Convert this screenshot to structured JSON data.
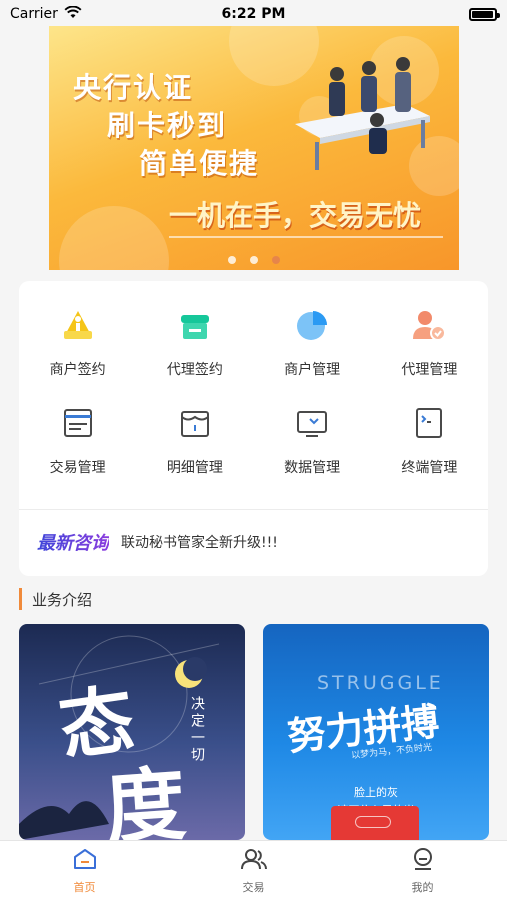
{
  "status": {
    "carrier": "Carrier",
    "time": "6:22 PM",
    "battery_level": 0.95
  },
  "banner": {
    "line1": "央行认证",
    "line2": "刷卡秒到",
    "line3": "简单便捷",
    "slogan": "一机在手，交易无忧",
    "dots": 3,
    "active_dot": 2
  },
  "menu": {
    "items": [
      {
        "label": "商户签约",
        "icon": "merchant-sign-icon"
      },
      {
        "label": "代理签约",
        "icon": "agent-sign-icon"
      },
      {
        "label": "商户管理",
        "icon": "merchant-manage-icon"
      },
      {
        "label": "代理管理",
        "icon": "agent-manage-icon"
      },
      {
        "label": "交易管理",
        "icon": "trade-manage-icon"
      },
      {
        "label": "明细管理",
        "icon": "detail-manage-icon"
      },
      {
        "label": "数据管理",
        "icon": "data-manage-icon"
      },
      {
        "label": "终端管理",
        "icon": "terminal-manage-icon"
      }
    ]
  },
  "news": {
    "title": "最新咨询",
    "text": "联动秘书管家全新升级!!!"
  },
  "section": {
    "title": "业务介绍"
  },
  "cards": {
    "left": {
      "big1": "态",
      "big2": "度",
      "vertical": "决定一切"
    },
    "right": {
      "struggle": "STRUGGLE",
      "headline": "努力拼搏",
      "small": "以梦为马，不负时光",
      "line1": "脸上的灰",
      "line2": "遮不住心里的光"
    }
  },
  "tabs": [
    {
      "label": "首页",
      "icon": "home-icon",
      "active": true
    },
    {
      "label": "交易",
      "icon": "users-icon",
      "active": false
    },
    {
      "label": "我的",
      "icon": "profile-icon",
      "active": false
    }
  ],
  "colors": {
    "accent": "#f08a3a",
    "news_gradient_start": "#3f46d9",
    "news_gradient_end": "#8a3cde"
  }
}
